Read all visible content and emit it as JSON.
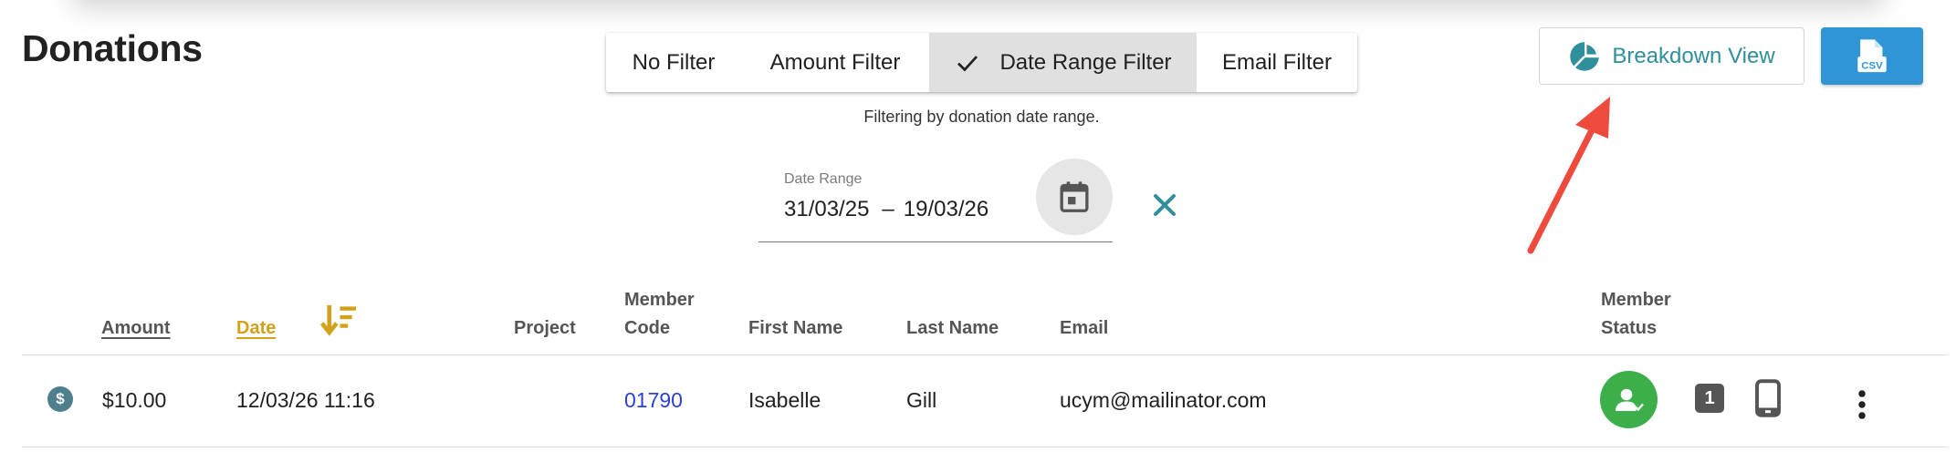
{
  "page": {
    "title": "Donations"
  },
  "filters": {
    "options": [
      "No Filter",
      "Amount Filter",
      "Date Range Filter",
      "Email Filter"
    ],
    "active": "Date Range Filter",
    "caption": "Filtering by donation date range."
  },
  "date_range": {
    "label": "Date Range",
    "start": "31/03/25",
    "separator": "–",
    "end": "19/03/26"
  },
  "toolbar": {
    "breakdown_label": "Breakdown View",
    "csv_icon_text": "CSV"
  },
  "table": {
    "headers": {
      "amount": "Amount",
      "date": "Date",
      "project": "Project",
      "member_code_line1": "Member",
      "member_code_line2": "Code",
      "first_name": "First Name",
      "last_name": "Last Name",
      "email": "Email",
      "member_status_line1": "Member",
      "member_status_line2": "Status"
    },
    "rows": [
      {
        "type_icon": "$",
        "amount": "$10.00",
        "date": "12/03/26 11:16",
        "project": "",
        "member_code": "01790",
        "first_name": "Isabelle",
        "last_name": "Gill",
        "email": "ucym@mailinator.com",
        "badge": "1"
      }
    ]
  },
  "colors": {
    "accent": "#2f8f9a",
    "csv_button": "#2f95d5",
    "sorted_header": "#d4a11a",
    "link": "#2b3fd9",
    "status_active": "#3caf4a",
    "annotation_arrow": "#ee4b3e"
  },
  "icons": [
    "check-icon",
    "calendar-icon",
    "clear-icon",
    "pie-chart-icon",
    "csv-file-icon",
    "sort-descending-icon",
    "dollar-icon",
    "member-verified-icon",
    "phone-icon",
    "more-vert-icon",
    "annotation-arrow"
  ]
}
